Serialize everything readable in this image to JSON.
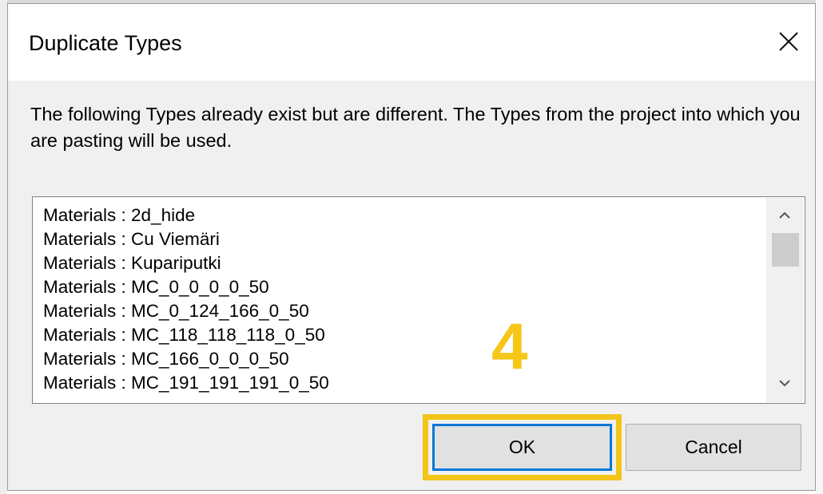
{
  "dialog": {
    "title": "Duplicate Types",
    "close_icon": "close-icon",
    "message": "The following Types already exist but are different. The Types from the project into which you are pasting will be used."
  },
  "list": {
    "items": [
      "Materials : 2d_hide",
      "Materials : Cu Viemäri",
      "Materials : Kupariputki",
      "Materials : MC_0_0_0_0_50",
      "Materials : MC_0_124_166_0_50",
      "Materials : MC_118_118_118_0_50",
      "Materials : MC_166_0_0_0_50",
      "Materials : MC_191_191_191_0_50"
    ],
    "scroll_up_icon": "chevron-up-icon",
    "scroll_down_icon": "chevron-down-icon"
  },
  "annotation": {
    "step_number": "4",
    "color": "#f6c619"
  },
  "buttons": {
    "ok_label": "OK",
    "cancel_label": "Cancel"
  },
  "colors": {
    "focus_border": "#0078d7",
    "highlight": "#f3c519"
  }
}
